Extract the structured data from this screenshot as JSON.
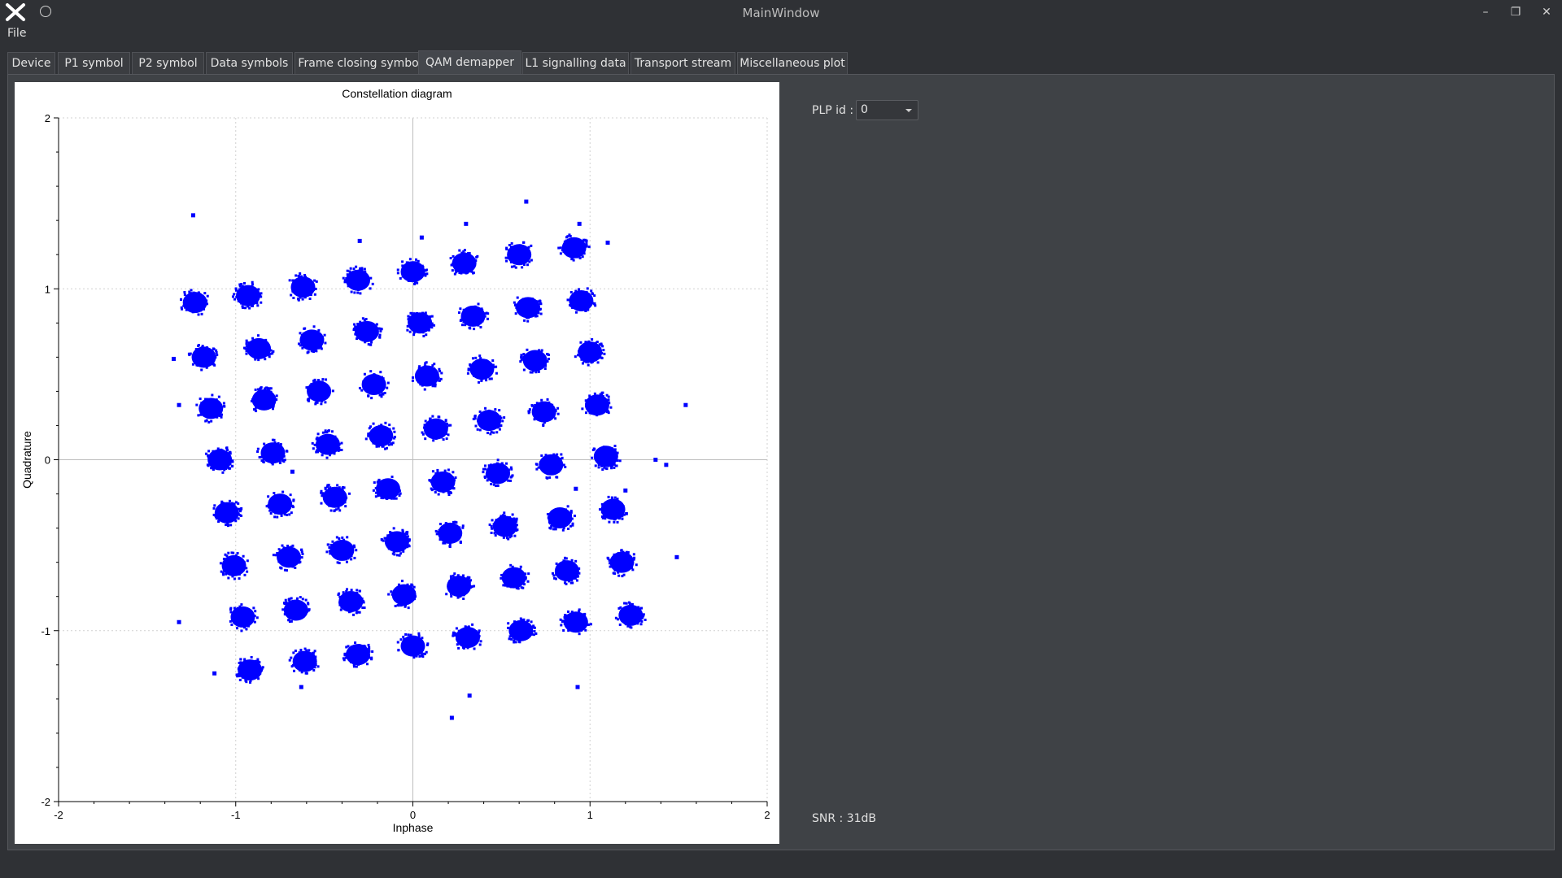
{
  "window": {
    "title": "MainWindow"
  },
  "menu": {
    "file_label": "File"
  },
  "window_controls": {
    "minimize": "–",
    "restore": "❐",
    "close": "✕"
  },
  "tabs": [
    {
      "label": "Device"
    },
    {
      "label": "P1 symbol"
    },
    {
      "label": "P2 symbol"
    },
    {
      "label": "Data symbols"
    },
    {
      "label": "Frame closing symbol"
    },
    {
      "label": "QAM demapper",
      "active": true
    },
    {
      "label": "L1 signalling data"
    },
    {
      "label": "Transport stream"
    },
    {
      "label": "Miscellaneous plot"
    }
  ],
  "controls": {
    "plp_label": "PLP id :",
    "plp_value": "0",
    "snr_text": "SNR : 31dB"
  },
  "colors": {
    "points": "#0000ff",
    "background": "#3f4246",
    "plot_bg": "#ffffff"
  },
  "chart_data": {
    "type": "scatter",
    "title": "Constellation diagram",
    "xlabel": "Inphase",
    "ylabel": "Quadrature",
    "xlim": [
      -2,
      2
    ],
    "ylim": [
      -2,
      2
    ],
    "xticks": [
      "-2",
      "-1",
      "0",
      "1",
      "2"
    ],
    "yticks": [
      "-2",
      "-1",
      "0",
      "1",
      "2"
    ],
    "grid": true,
    "clusters": [
      [
        -1.23,
        0.92
      ],
      [
        -0.93,
        0.96
      ],
      [
        -0.62,
        1.01
      ],
      [
        -0.31,
        1.05
      ],
      [
        0.0,
        1.1
      ],
      [
        0.29,
        1.15
      ],
      [
        0.6,
        1.2
      ],
      [
        0.91,
        1.24
      ],
      [
        -1.18,
        0.6
      ],
      [
        -0.87,
        0.65
      ],
      [
        -0.57,
        0.7
      ],
      [
        -0.26,
        0.75
      ],
      [
        0.04,
        0.8
      ],
      [
        0.34,
        0.84
      ],
      [
        0.65,
        0.89
      ],
      [
        0.95,
        0.93
      ],
      [
        -1.14,
        0.3
      ],
      [
        -0.84,
        0.35
      ],
      [
        -0.53,
        0.4
      ],
      [
        -0.22,
        0.44
      ],
      [
        0.08,
        0.49
      ],
      [
        0.39,
        0.53
      ],
      [
        0.69,
        0.58
      ],
      [
        1.0,
        0.63
      ],
      [
        -1.09,
        0.0
      ],
      [
        -0.79,
        0.04
      ],
      [
        -0.48,
        0.09
      ],
      [
        -0.18,
        0.14
      ],
      [
        0.13,
        0.18
      ],
      [
        0.43,
        0.23
      ],
      [
        0.74,
        0.28
      ],
      [
        1.04,
        0.32
      ],
      [
        -1.05,
        -0.31
      ],
      [
        -0.75,
        -0.26
      ],
      [
        -0.44,
        -0.22
      ],
      [
        -0.14,
        -0.17
      ],
      [
        0.17,
        -0.13
      ],
      [
        0.48,
        -0.08
      ],
      [
        0.78,
        -0.03
      ],
      [
        1.09,
        0.02
      ],
      [
        -1.01,
        -0.62
      ],
      [
        -0.7,
        -0.57
      ],
      [
        -0.4,
        -0.53
      ],
      [
        -0.09,
        -0.48
      ],
      [
        0.21,
        -0.43
      ],
      [
        0.52,
        -0.39
      ],
      [
        0.83,
        -0.34
      ],
      [
        1.13,
        -0.29
      ],
      [
        -0.96,
        -0.92
      ],
      [
        -0.66,
        -0.88
      ],
      [
        -0.35,
        -0.83
      ],
      [
        -0.05,
        -0.79
      ],
      [
        0.26,
        -0.74
      ],
      [
        0.57,
        -0.69
      ],
      [
        0.87,
        -0.65
      ],
      [
        1.18,
        -0.6
      ],
      [
        -0.92,
        -1.23
      ],
      [
        -0.61,
        -1.18
      ],
      [
        -0.31,
        -1.14
      ],
      [
        0.0,
        -1.09
      ],
      [
        0.31,
        -1.04
      ],
      [
        0.61,
        -1.0
      ],
      [
        0.92,
        -0.95
      ],
      [
        1.23,
        -0.91
      ]
    ],
    "outliers": [
      [
        -1.24,
        1.43
      ],
      [
        0.3,
        1.38
      ],
      [
        0.64,
        1.51
      ],
      [
        -0.3,
        1.28
      ],
      [
        0.05,
        1.3
      ],
      [
        1.1,
        1.27
      ],
      [
        0.94,
        1.38
      ],
      [
        -1.35,
        0.59
      ],
      [
        -1.32,
        0.32
      ],
      [
        1.54,
        0.32
      ],
      [
        1.37,
        0.0
      ],
      [
        1.43,
        -0.03
      ],
      [
        1.49,
        -0.57
      ],
      [
        -1.32,
        -0.95
      ],
      [
        -1.12,
        -1.25
      ],
      [
        0.22,
        -1.51
      ],
      [
        0.32,
        -1.38
      ],
      [
        0.93,
        -1.33
      ],
      [
        -0.63,
        -1.33
      ],
      [
        -0.68,
        -0.07
      ],
      [
        0.92,
        -0.17
      ],
      [
        1.2,
        -0.18
      ]
    ]
  }
}
